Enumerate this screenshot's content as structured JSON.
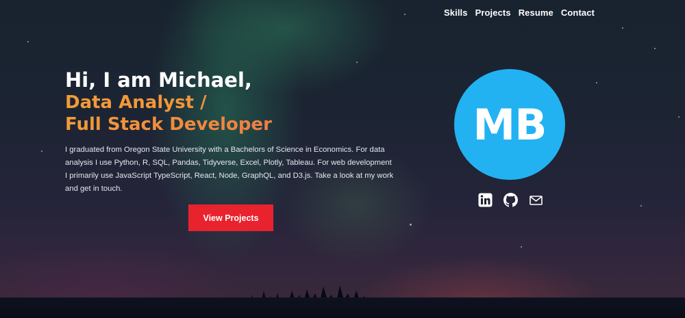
{
  "nav": {
    "items": [
      {
        "label": "Skills"
      },
      {
        "label": "Projects"
      },
      {
        "label": "Resume"
      },
      {
        "label": "Contact"
      }
    ]
  },
  "hero": {
    "greeting": "Hi, I am Michael,",
    "role_line1": "Data Analyst /",
    "role_line2": "Full Stack Developer",
    "bio": "I graduated from Oregon State University with a Bachelors of Science in Economics. For data analysis I use Python, R, SQL, Pandas, Tidyverse, Excel, Plotly, Tableau. For web development I primarily use JavaScript TypeScript, React, Node, GraphQL, and D3.js. Take a look at my work and get in touch.",
    "cta_label": "View Projects"
  },
  "profile": {
    "initials": "MB",
    "avatar_color": "#22b2f2",
    "socials": [
      {
        "icon": "linkedin-icon"
      },
      {
        "icon": "github-icon"
      },
      {
        "icon": "mail-icon"
      }
    ]
  },
  "colors": {
    "accent_orange": "#f39b37",
    "accent_coral": "#ee6a5b",
    "button_red": "#e8232e"
  }
}
